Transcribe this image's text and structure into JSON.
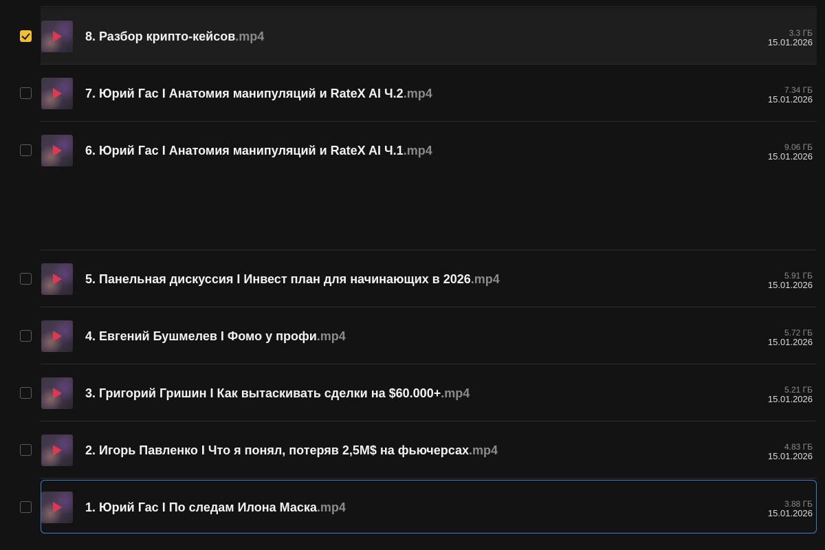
{
  "files": [
    {
      "name": "8. Разбор крипто-кейсов",
      "ext": ".mp4",
      "size": "3.3 ГБ",
      "date": "15.01.2026",
      "checked": true,
      "state": "selected"
    },
    {
      "name": "7. Юрий Гас I Анатомия манипуляций и RateX AI Ч.2",
      "ext": ".mp4",
      "size": "7.34 ГБ",
      "date": "15.01.2026",
      "checked": false,
      "state": ""
    },
    {
      "name": "6. Юрий Гас I Анатомия манипуляций и RateX AI Ч.1",
      "ext": ".mp4",
      "size": "9.06 ГБ",
      "date": "15.01.2026",
      "checked": false,
      "state": ""
    },
    {
      "name": "5. Панельная дискуссия I Инвест план для начинающих в 2026",
      "ext": ".mp4",
      "size": "5.91 ГБ",
      "date": "15.01.2026",
      "checked": false,
      "state": ""
    },
    {
      "name": "4. Евгений Бушмелев I Фомо у профи",
      "ext": ".mp4",
      "size": "5.72 ГБ",
      "date": "15.01.2026",
      "checked": false,
      "state": ""
    },
    {
      "name": "3. Григорий Гришин I Как вытаскивать сделки на $60.000+",
      "ext": ".mp4",
      "size": "5.21 ГБ",
      "date": "15.01.2026",
      "checked": false,
      "state": ""
    },
    {
      "name": "2. Игорь Павленко I Что я понял, потеряв 2,5M$ на фьючерсах",
      "ext": ".mp4",
      "size": "4.83 ГБ",
      "date": "15.01.2026",
      "checked": false,
      "state": ""
    },
    {
      "name": "1. Юрий Гас I По следам Илона Маска",
      "ext": ".mp4",
      "size": "3.88 ГБ",
      "date": "15.01.2026",
      "checked": false,
      "state": "focused"
    }
  ],
  "icons": {
    "thumbnail": "video-thumbnail-icon",
    "play": "play-icon",
    "checkbox": "checkbox-icon"
  },
  "colors": {
    "background": "#131313",
    "accent_checkbox": "#f3bf2f",
    "focus_ring": "#3d7ec4",
    "extension": "#8a8a8a"
  }
}
